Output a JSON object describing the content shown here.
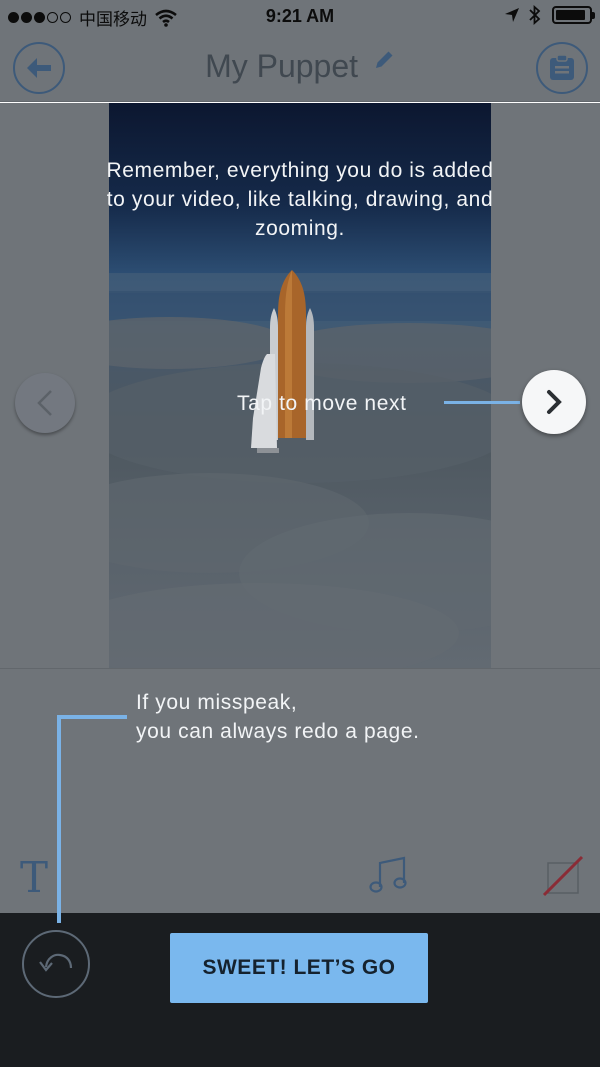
{
  "status_bar": {
    "carrier": "中国移动",
    "time": "9:21 AM",
    "signal_bars": 3,
    "signal_total": 5,
    "battery_level": 0.9,
    "icons": [
      "signal-dots-icon",
      "wifi-icon",
      "location-arrow-icon",
      "bluetooth-icon",
      "battery-icon"
    ]
  },
  "header": {
    "title": "My Puppet",
    "back_icon": "arrow-left-icon",
    "edit_icon": "pencil-icon",
    "menu_icon": "clipboard-icon"
  },
  "slide": {
    "image": "space-shuttle-above-clouds",
    "prev_icon": "chevron-left-icon"
  },
  "coach": {
    "slide_tip": "Remember, everything you do is added to your video, like talking, drawing, and zooming.",
    "next_tip": "Tap to move next",
    "next_icon": "chevron-right-icon",
    "redo_tip": "If you misspeak,\nyou can always redo a page."
  },
  "tools": {
    "text_label": "T",
    "music_icon": "music-note-icon",
    "pen_icon": "pen-icon",
    "redo_icon": "undo-icon"
  },
  "cta": {
    "label": "SWEET! LET’S GO"
  },
  "colors": {
    "accent": "#7ab8ee",
    "overlay": "#6f7479",
    "bottom_bar": "#1a1d20",
    "icon_dim": "#3d5a7a",
    "pen_red": "#8a2c36"
  }
}
